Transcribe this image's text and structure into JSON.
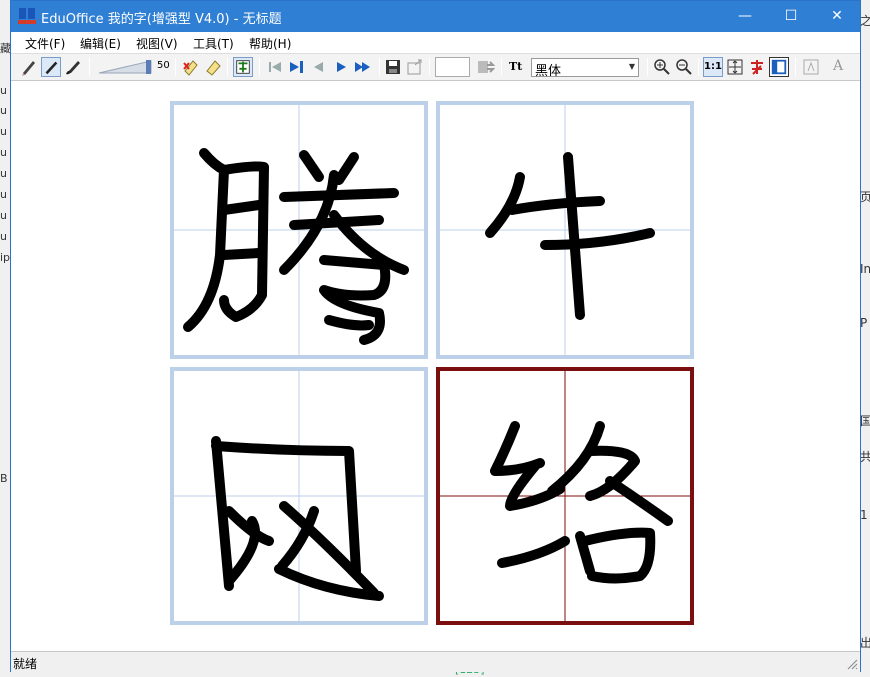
{
  "window": {
    "title": "EduOffice 我的字(增强型 V4.0) - 无标题",
    "minimize": "—",
    "maximize": "☐",
    "close": "✕"
  },
  "menu": [
    "文件(F)",
    "编辑(E)",
    "视图(V)",
    "工具(T)",
    "帮助(H)"
  ],
  "toolbar": {
    "slider_value": "50",
    "font_name": "黑体",
    "font_type_icon": "Tt",
    "ratio_label": "1:1",
    "small_label_1": "A"
  },
  "grid": {
    "characters": [
      "滕",
      "牛",
      "网",
      "络"
    ],
    "selected_index": 3,
    "cell_border_color": "#bcd0ea",
    "selected_border_color": "#7b0f0f",
    "guide_color": "#bcd0ea",
    "selected_guide_color": "#7b0f0f"
  },
  "status": {
    "text": "就绪"
  },
  "background": {
    "left_glyphs": [
      "藏",
      "u",
      "u",
      "u",
      "u",
      "u",
      "u",
      "u",
      "u",
      "ip",
      "B"
    ],
    "right_glyphs": [
      "之",
      "页",
      "In",
      "P",
      "国",
      "共",
      "1",
      "出"
    ],
    "bottom_text": "[123]"
  }
}
